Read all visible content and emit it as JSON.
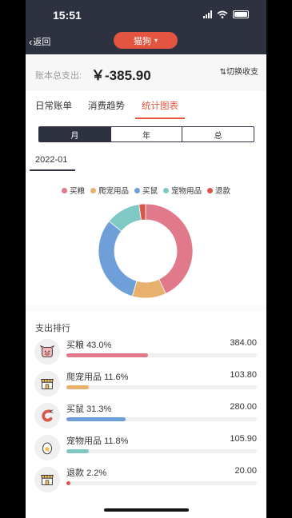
{
  "status_bar": {
    "time": "15:51"
  },
  "header": {
    "back_label": "返回",
    "title": "猫狗"
  },
  "summary": {
    "label": "账本总支出:",
    "value": "￥-385.90",
    "switch_label": "⇅切换收支"
  },
  "tabs": [
    {
      "label": "日常账单",
      "active": false
    },
    {
      "label": "消费趋势",
      "active": false
    },
    {
      "label": "统计图表",
      "active": true
    }
  ],
  "period_tabs": [
    {
      "label": "月",
      "active": true
    },
    {
      "label": "年",
      "active": false
    },
    {
      "label": "总",
      "active": false
    }
  ],
  "selected_month": "2022-01",
  "chart_data": {
    "type": "pie",
    "donut": true,
    "legend_position": "top",
    "categories": [
      "买粮",
      "爬宠用品",
      "买鼠",
      "宠物用品",
      "退款"
    ],
    "values": [
      384.0,
      103.8,
      280.0,
      105.9,
      20.0
    ],
    "colors": [
      "#e07a8a",
      "#e8b06d",
      "#6f9fd8",
      "#7fc8c4",
      "#d9574a"
    ]
  },
  "ranking": {
    "title": "支出排行",
    "items": [
      {
        "name": "买粮",
        "percent": "43.0%",
        "amount": "384.00",
        "ratio": 0.43,
        "color": "#e07a8a",
        "icon": "dog-food-icon"
      },
      {
        "name": "爬宠用品",
        "percent": "11.6%",
        "amount": "103.80",
        "ratio": 0.116,
        "color": "#e8b06d",
        "icon": "shop-icon"
      },
      {
        "name": "买鼠",
        "percent": "31.3%",
        "amount": "280.00",
        "ratio": 0.313,
        "color": "#6f9fd8",
        "icon": "shrimp-icon"
      },
      {
        "name": "宠物用品",
        "percent": "11.8%",
        "amount": "105.90",
        "ratio": 0.118,
        "color": "#7fc8c4",
        "icon": "egg-icon"
      },
      {
        "name": "退款",
        "percent": "2.2%",
        "amount": "20.00",
        "ratio": 0.022,
        "color": "#d9574a",
        "icon": "shop-icon"
      }
    ]
  }
}
